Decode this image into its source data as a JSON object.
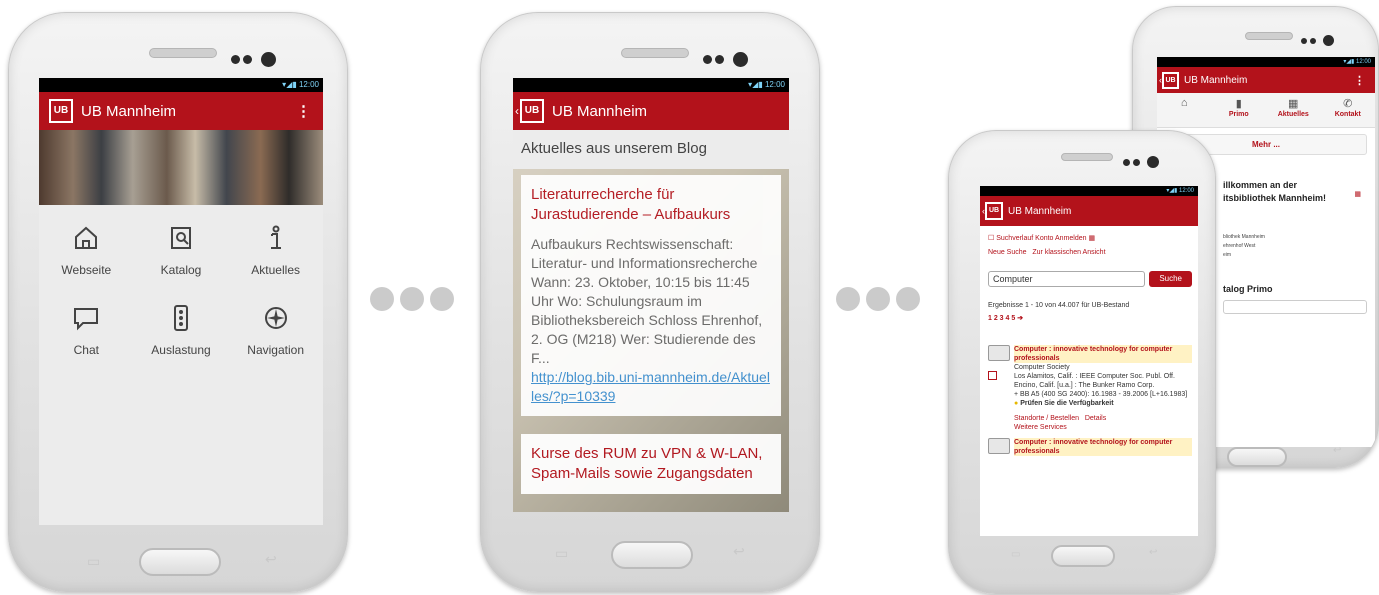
{
  "colors": {
    "brand": "#b3121b",
    "link": "#3b8fd2",
    "status_icons": "#7fd3f7"
  },
  "status_time": "12:00",
  "app_title": "UB Mannheim",
  "logo_text": "UB",
  "separator_icon": "ellipsis-dots",
  "phone1": {
    "menu_icon": "overflow-menu-icon",
    "tiles": [
      {
        "label": "Webseite",
        "icon": "home-icon"
      },
      {
        "label": "Katalog",
        "icon": "catalog-search-icon"
      },
      {
        "label": "Aktuelles",
        "icon": "info-icon"
      },
      {
        "label": "Chat",
        "icon": "chat-icon"
      },
      {
        "label": "Auslastung",
        "icon": "traffic-light-icon"
      },
      {
        "label": "Navigation",
        "icon": "compass-icon"
      }
    ]
  },
  "phone2": {
    "header": "Aktuelles aus unserem Blog",
    "post1_title": "Literaturrecherche für Jurastudierende – Aufbaukurs",
    "post1_body": "Aufbaukurs Rechtswissenschaft: Literatur- und Informationsrecherche Wann: 23. Oktober, 10:15 bis 11:45 Uhr Wo: Schulungsraum im Bibliotheksbereich Schloss Ehrenhof, 2. OG (M218) Wer: Studierende des F...",
    "post1_link": "http://blog.bib.uni-mannheim.de/Aktuelles/?p=10339",
    "post2_title": "Kurse des RUM zu VPN & W-LAN, Spam-Mails sowie Zugangsdaten"
  },
  "phone3": {
    "nav_links": [
      "Suchverlauf",
      "Konto",
      "Anmelden"
    ],
    "sub_links": [
      "Neue Suche",
      "Zur klassischen Ansicht"
    ],
    "search_value": "Computer",
    "search_button": "Suche",
    "results_text": "Ergebnisse 1 - 10 von 44.007 für UB-Bestand",
    "pages": "1 2 3 4 5 ➔",
    "result1_title": "Computer : innovative technology for computer professionals",
    "result1_author": "Computer Society",
    "result1_pub": "Los Alamitos, Calif. : IEEE Computer Soc. Publ. Off. Encino, Calif. [u.a.] : The Bunker Ramo Corp.",
    "result1_call": "+ BB A5 (400 SG 2400): 16.1983 - 39.2006 [L+16.1983]",
    "result1_availability": "Prüfen Sie die Verfügbarkeit",
    "result1_actions": [
      "Standorte / Bestellen",
      "Details",
      "Weitere Services"
    ],
    "result2_title": "Computer : innovative technology for computer professionals"
  },
  "phone4": {
    "tabs": [
      {
        "label": "",
        "icon": "home-icon"
      },
      {
        "label": "Primo",
        "icon": "book-icon"
      },
      {
        "label": "Aktuelles",
        "icon": "calendar-icon"
      },
      {
        "label": "Kontakt",
        "icon": "phone-icon"
      }
    ],
    "more_button": "Mehr ...",
    "welcome_line1": "illkommen an der",
    "welcome_line2": "itsbibliothek Mannheim!",
    "address_lines": [
      "bliothek Mannheim",
      "ehrenhof West",
      "eim"
    ],
    "catalog_heading": "talog Primo"
  }
}
